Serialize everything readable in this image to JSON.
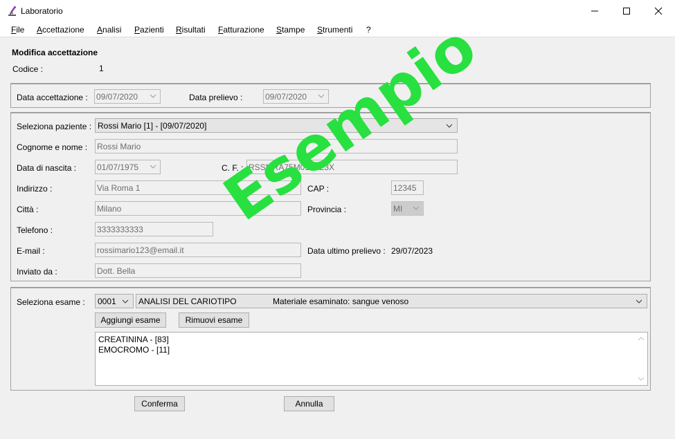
{
  "window": {
    "title": "Laboratorio"
  },
  "menu": [
    "File",
    "Accettazione",
    "Analisi",
    "Pazienti",
    "Risultati",
    "Fatturazione",
    "Stampe",
    "Strumenti",
    "?"
  ],
  "header": {
    "title": "Modifica accettazione",
    "code_label": "Codice :",
    "code_value": "1"
  },
  "dates": {
    "acceptance_label": "Data accettazione :",
    "acceptance_value": "09/07/2020",
    "sampling_label": "Data prelievo :",
    "sampling_value": "09/07/2020"
  },
  "patient": {
    "select_label": "Seleziona paziente :",
    "select_value": "Rossi Mario [1] - [09/07/2020]",
    "name_label": "Cognome e nome :",
    "name_value": "Rossi Mario",
    "birth_label": "Data di nascita :",
    "birth_value": "01/07/1975",
    "cf_label": "C. F. :",
    "cf_value": "RSSMRA75M01A123X",
    "address_label": "Indirizzo :",
    "address_value": "Via Roma 1",
    "cap_label": "CAP :",
    "cap_value": "12345",
    "city_label": "Città :",
    "city_value": "Milano",
    "province_label": "Provincia :",
    "province_value": "MI",
    "phone_label": "Telefono :",
    "phone_value": "3333333333",
    "email_label": "E-mail :",
    "email_value": "rossimario123@email.it",
    "last_sampling_label": "Data ultimo prelievo :",
    "last_sampling_value": "29/07/2023",
    "sent_by_label": "Inviato da :",
    "sent_by_value": "Dott. Bella"
  },
  "exam": {
    "select_label": "Seleziona esame :",
    "code_value": "0001",
    "name_value": "ANALISI DEL CARIOTIPO",
    "material_value": "Materiale esaminato: sangue venoso",
    "add_button": "Aggiungi esame",
    "remove_button": "Rimuovi esame",
    "list": [
      "CREATININA - [83]",
      "EMOCROMO - [11]"
    ]
  },
  "footer": {
    "confirm_button": "Conferma",
    "cancel_button": "Annulla"
  },
  "watermark": "Esempio",
  "colors": {
    "watermark": "#28e040",
    "window_bg": "#f0f0f0"
  }
}
